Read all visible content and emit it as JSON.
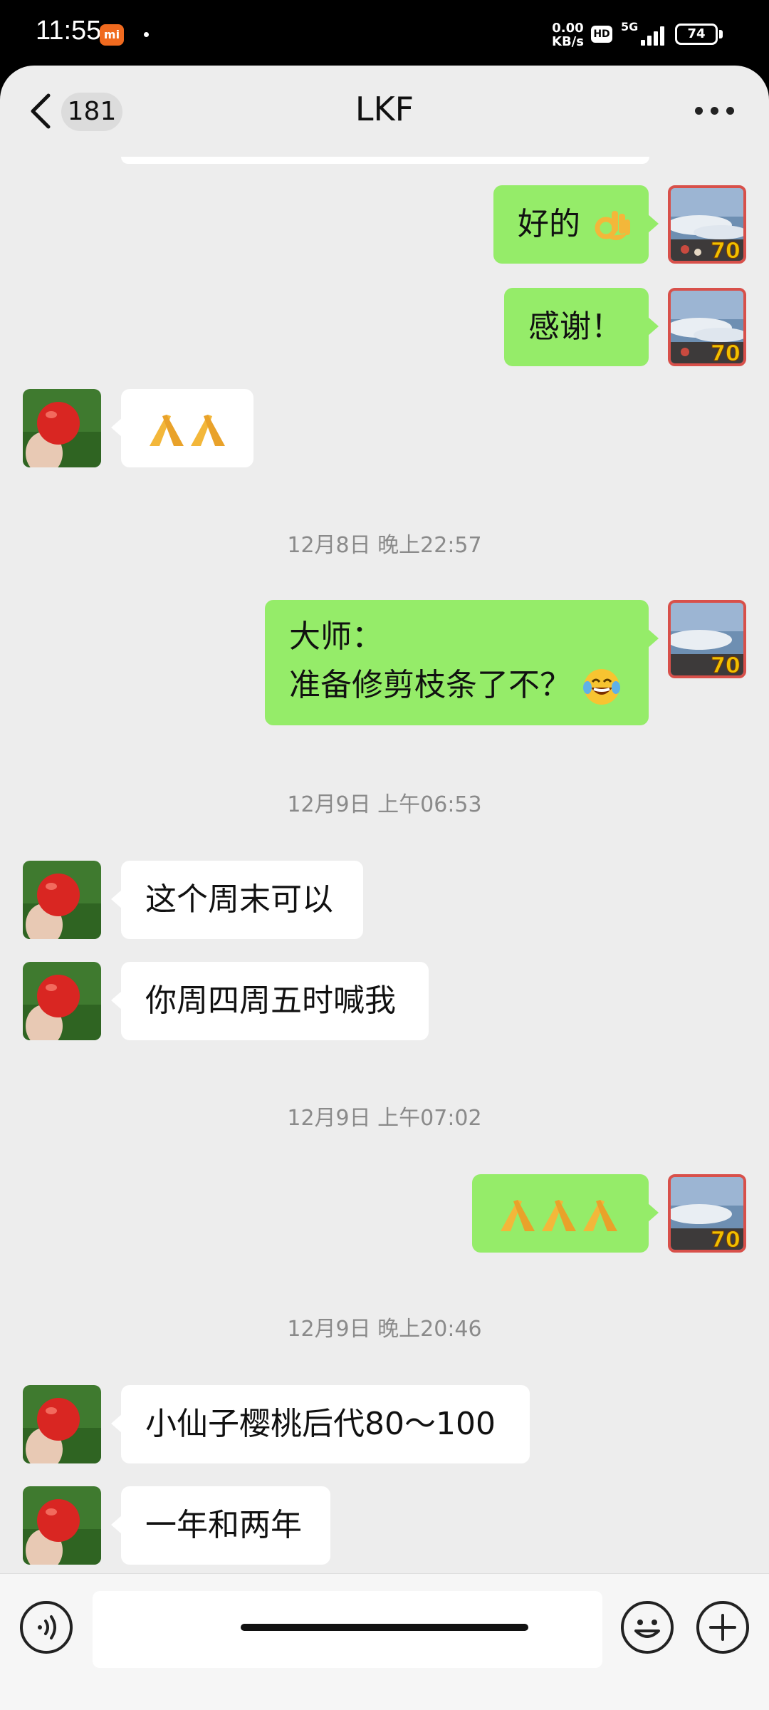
{
  "status_bar": {
    "time": "11:55",
    "mi_badge": "mi",
    "net_speed_value": "0.00",
    "net_speed_unit": "KB/s",
    "hd": "HD",
    "network": "5G",
    "battery": "74"
  },
  "header": {
    "unread_count": "181",
    "title": "LKF"
  },
  "messages": [
    {
      "side": "out",
      "text": "好的"
    },
    {
      "side": "out",
      "text": "感谢！"
    },
    {
      "side": "in",
      "text": ""
    },
    {
      "timestamp": "12月8日 晚上22:57"
    },
    {
      "side": "out",
      "line1": "大师：",
      "line2": "准备修剪枝条了不？"
    },
    {
      "timestamp": "12月9日 上午06:53"
    },
    {
      "side": "in",
      "text": "这个周末可以"
    },
    {
      "side": "in",
      "text": "你周四周五时喊我"
    },
    {
      "timestamp": "12月9日 上午07:02"
    },
    {
      "side": "out",
      "text": ""
    },
    {
      "timestamp": "12月9日 晚上20:46"
    },
    {
      "side": "in",
      "text": "小仙子樱桃后代80～100"
    },
    {
      "side": "in",
      "text": "一年和两年"
    }
  ],
  "icons": {
    "ok_hand": "ok-hand-emoji",
    "pray": "pray-emoji",
    "laugh": "tears-of-joy-emoji"
  },
  "colors": {
    "outgoing_bubble": "#95ec69",
    "incoming_bubble": "#ffffff",
    "chat_background": "#ededed"
  }
}
